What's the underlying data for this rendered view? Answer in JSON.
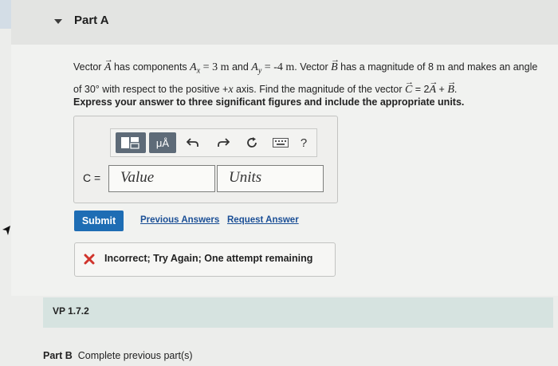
{
  "header": {
    "title": "Part A"
  },
  "problem": {
    "t1": "Vector ",
    "vecA": "A",
    "t2": " has components ",
    "ax": "A",
    "ax_sub": "x",
    "ax_val": " = 3 m",
    "t3": " and ",
    "ay": "A",
    "ay_sub": "y",
    "ay_val": " = -4 m",
    "t4": ". Vector ",
    "vecB": "B",
    "t5": " has a magnitude of 8 ",
    "unit_m": "m",
    "t6": " and makes an angle",
    "t7": "of 30° with respect to the positive +",
    "x_var": "x",
    "t8": " axis. Find the magnitude of the vector ",
    "vecC": "C",
    "eq": " = 2",
    "vecA2": "A",
    "plus": " + ",
    "vecB2": "B",
    "period": "."
  },
  "instruction": "Express your answer to three significant figures and include the appropriate units.",
  "toolbar": {
    "units_label": "μÅ",
    "help_label": "?"
  },
  "answer": {
    "label": "C =",
    "value_placeholder": "Value",
    "units_placeholder": "Units"
  },
  "actions": {
    "submit": "Submit",
    "previous_answers": "Previous Answers",
    "request_answer": "Request Answer"
  },
  "feedback": {
    "text": "Incorrect; Try Again; One attempt remaining"
  },
  "vp": {
    "label": "VP 1.7.2"
  },
  "part_b": {
    "title": "Part B",
    "status": "Complete previous part(s)"
  },
  "colors": {
    "submit_bg": "#1e6db4",
    "link": "#1b4f96",
    "error": "#d0342c",
    "vp_band": "#d6e3e0"
  }
}
